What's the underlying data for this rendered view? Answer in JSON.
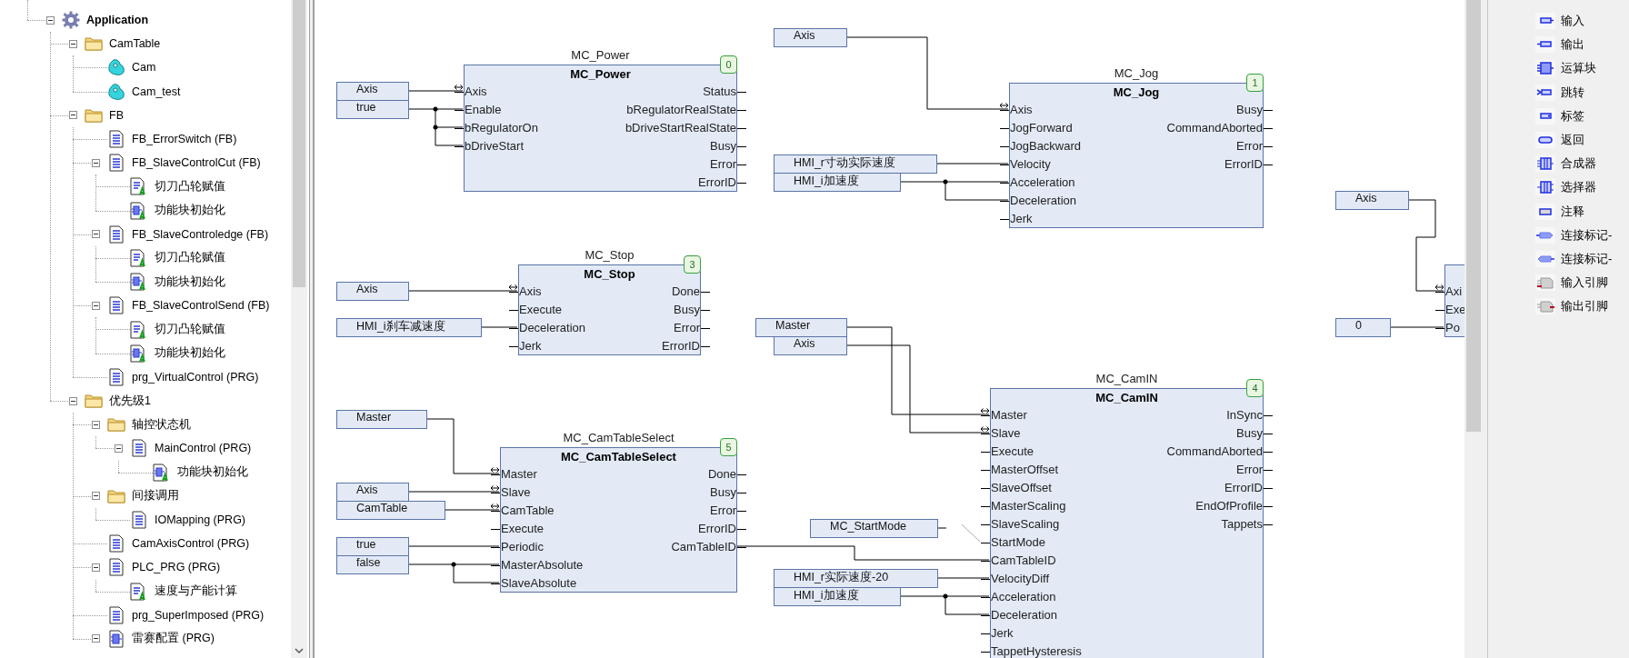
{
  "project_tree": {
    "items": [
      {
        "label": "Application",
        "kind": "application",
        "expanded": true,
        "children": [
          {
            "label": "CamTable",
            "kind": "folder",
            "expanded": true,
            "children": [
              {
                "label": "Cam",
                "kind": "cam"
              },
              {
                "label": "Cam_test",
                "kind": "cam"
              }
            ]
          },
          {
            "label": "FB",
            "kind": "folder",
            "expanded": true,
            "children": [
              {
                "label": "FB_ErrorSwitch (FB)",
                "kind": "pou"
              },
              {
                "label": "FB_SlaveControlCut (FB)",
                "kind": "pou",
                "expanded": true,
                "children": [
                  {
                    "label": "切刀凸轮赋值",
                    "kind": "action_st"
                  },
                  {
                    "label": "功能块初始化",
                    "kind": "action_cfc"
                  }
                ]
              },
              {
                "label": "FB_SlaveControledge (FB)",
                "kind": "pou",
                "expanded": true,
                "children": [
                  {
                    "label": "切刀凸轮赋值",
                    "kind": "action_st"
                  },
                  {
                    "label": "功能块初始化",
                    "kind": "action_cfc"
                  }
                ]
              },
              {
                "label": "FB_SlaveControlSend (FB)",
                "kind": "pou",
                "expanded": true,
                "children": [
                  {
                    "label": "切刀凸轮赋值",
                    "kind": "action_st"
                  },
                  {
                    "label": "功能块初始化",
                    "kind": "action_cfc"
                  }
                ]
              },
              {
                "label": "prg_VirtualControl (PRG)",
                "kind": "pou"
              }
            ]
          },
          {
            "label": "优先级1",
            "kind": "folder",
            "expanded": true,
            "children": [
              {
                "label": "轴控状态机",
                "kind": "folder",
                "expanded": true,
                "children": [
                  {
                    "label": "MainControl (PRG)",
                    "kind": "pou",
                    "expanded": true,
                    "children": [
                      {
                        "label": "功能块初始化",
                        "kind": "action_cfc"
                      }
                    ]
                  }
                ]
              },
              {
                "label": "间接调用",
                "kind": "folder",
                "expanded": true,
                "children": [
                  {
                    "label": "IOMapping (PRG)",
                    "kind": "pou"
                  }
                ]
              },
              {
                "label": "CamAxisControl (PRG)",
                "kind": "pou"
              },
              {
                "label": "PLC_PRG (PRG)",
                "kind": "pou",
                "expanded": true,
                "children": [
                  {
                    "label": "速度与产能计算",
                    "kind": "action_st"
                  }
                ]
              },
              {
                "label": "prg_SuperImposed (PRG)",
                "kind": "pou"
              },
              {
                "label": "雷赛配置 (PRG)",
                "kind": "pou_cfc",
                "expanded": true
              }
            ]
          }
        ]
      }
    ]
  },
  "cfc_editor": {
    "blocks": [
      {
        "instance": "MC_Power",
        "type": "MC_Power",
        "order": "0",
        "inputs": [
          {
            "name": "Axis",
            "inout": true
          },
          {
            "name": "Enable",
            "inout": false
          },
          {
            "name": "bRegulatorOn",
            "inout": false
          },
          {
            "name": "bDriveStart",
            "inout": false
          }
        ],
        "outputs": [
          "Status",
          "bRegulatorRealState",
          "bDriveStartRealState",
          "Busy",
          "Error",
          "ErrorID"
        ]
      },
      {
        "instance": "MC_Jog",
        "type": "MC_Jog",
        "order": "1",
        "inputs": [
          {
            "name": "Axis",
            "inout": true
          },
          {
            "name": "JogForward",
            "inout": false
          },
          {
            "name": "JogBackward",
            "inout": false
          },
          {
            "name": "Velocity",
            "inout": false
          },
          {
            "name": "Acceleration",
            "inout": false
          },
          {
            "name": "Deceleration",
            "inout": false
          },
          {
            "name": "Jerk",
            "inout": false
          }
        ],
        "outputs": [
          "Busy",
          "CommandAborted",
          "Error",
          "ErrorID"
        ]
      },
      {
        "instance": "MC_Stop",
        "type": "MC_Stop",
        "order": "3",
        "inputs": [
          {
            "name": "Axis",
            "inout": true
          },
          {
            "name": "Execute",
            "inout": false
          },
          {
            "name": "Deceleration",
            "inout": false
          },
          {
            "name": "Jerk",
            "inout": false
          }
        ],
        "outputs": [
          "Done",
          "Busy",
          "Error",
          "ErrorID"
        ]
      },
      {
        "instance": "MC_CamTableSelect",
        "type": "MC_CamTableSelect",
        "order": "5",
        "inputs": [
          {
            "name": "Master",
            "inout": true
          },
          {
            "name": "Slave",
            "inout": true
          },
          {
            "name": "CamTable",
            "inout": true
          },
          {
            "name": "Execute",
            "inout": false
          },
          {
            "name": "Periodic",
            "inout": false
          },
          {
            "name": "MasterAbsolute",
            "inout": false
          },
          {
            "name": "SlaveAbsolute",
            "inout": false
          }
        ],
        "outputs": [
          "Done",
          "Busy",
          "Error",
          "ErrorID",
          "CamTableID"
        ]
      },
      {
        "instance": "MC_CamIN",
        "type": "MC_CamIN",
        "order": "4",
        "inputs": [
          {
            "name": "Master",
            "inout": true
          },
          {
            "name": "Slave",
            "inout": true
          },
          {
            "name": "Execute",
            "inout": false
          },
          {
            "name": "MasterOffset",
            "inout": false
          },
          {
            "name": "SlaveOffset",
            "inout": false
          },
          {
            "name": "MasterScaling",
            "inout": false
          },
          {
            "name": "SlaveScaling",
            "inout": false
          },
          {
            "name": "StartMode",
            "inout": false
          },
          {
            "name": "CamTableID",
            "inout": false
          },
          {
            "name": "VelocityDiff",
            "inout": false
          },
          {
            "name": "Acceleration",
            "inout": false
          },
          {
            "name": "Deceleration",
            "inout": false
          },
          {
            "name": "Jerk",
            "inout": false
          },
          {
            "name": "TappetHysteresis",
            "inout": false
          }
        ],
        "outputs": [
          "InSync",
          "Busy",
          "CommandAborted",
          "Error",
          "ErrorID",
          "EndOfProfile",
          "Tappets"
        ]
      },
      {
        "inputs": [
          {
            "name": "Axi",
            "inout": true
          },
          {
            "name": "Exe",
            "inout": false
          },
          {
            "name": "Po",
            "inout": false
          }
        ]
      }
    ],
    "variables": [
      "Axis",
      "Axis",
      "true",
      "HMI_r寸动实际速度",
      "HMI_i加速度",
      "Axis",
      "Axis",
      "HMI_i刹车减速度",
      "Master",
      "Axis",
      "0",
      "Master",
      "Axis",
      "CamTable",
      "MC_StartMode",
      "true",
      "false",
      "HMI_r实际速度-20",
      "HMI_i加速度"
    ]
  },
  "toolbox": {
    "items": [
      {
        "label": "输入",
        "kind": "input"
      },
      {
        "label": "输出",
        "kind": "output"
      },
      {
        "label": "运算块",
        "kind": "box"
      },
      {
        "label": "跳转",
        "kind": "jump"
      },
      {
        "label": "标签",
        "kind": "label"
      },
      {
        "label": "返回",
        "kind": "return"
      },
      {
        "label": "合成器",
        "kind": "composer"
      },
      {
        "label": "选择器",
        "kind": "selector"
      },
      {
        "label": "注释",
        "kind": "comment"
      },
      {
        "label": "连接标记-",
        "kind": "connection_source"
      },
      {
        "label": "连接标记-",
        "kind": "connection_sink"
      },
      {
        "label": "输入引脚",
        "kind": "input_pin"
      },
      {
        "label": "输出引脚",
        "kind": "output_pin"
      }
    ]
  }
}
